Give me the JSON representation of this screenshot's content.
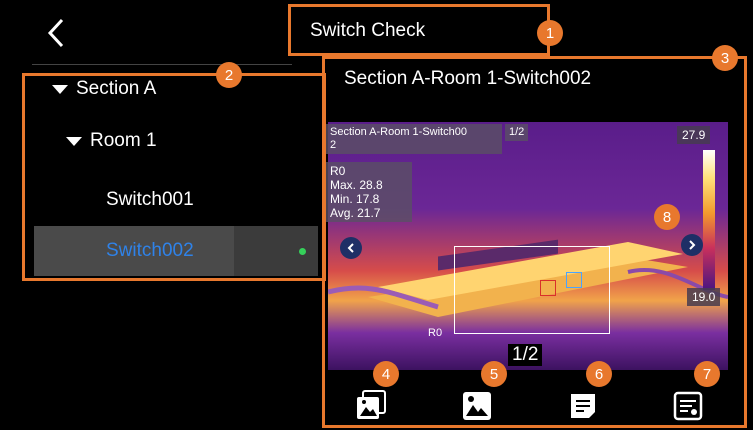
{
  "header": {
    "title": "Switch Check"
  },
  "sidebar": {
    "items": [
      {
        "label": "Section A"
      },
      {
        "label": "Room 1"
      },
      {
        "label": "Switch001"
      },
      {
        "label": "Switch002"
      }
    ]
  },
  "main": {
    "title": "Section A-Room 1-Switch002",
    "image": {
      "name": "Section A-Room 1-Switch00\n2",
      "page_small": "1/2",
      "page_big": "1/2",
      "temp_max_scale": "27.9",
      "temp_min_scale": "19.0",
      "roi": {
        "label": "R0",
        "max": "Max.  28.8",
        "min": "Min.   17.8",
        "avg": "Avg.   21.7"
      },
      "roi_label": "R0"
    }
  },
  "badges": [
    "1",
    "2",
    "3",
    "4",
    "5",
    "6",
    "7",
    "8"
  ],
  "colors": {
    "accent": "#e8782d",
    "selected_text": "#2f82e8",
    "bg": "#000000",
    "sidebar_selected_bg": "#4a4a4a"
  },
  "icons": [
    "back-arrow-icon",
    "gallery-stack-icon",
    "image-icon",
    "note-icon",
    "report-icon",
    "chevron-left-icon",
    "chevron-right-icon"
  ]
}
